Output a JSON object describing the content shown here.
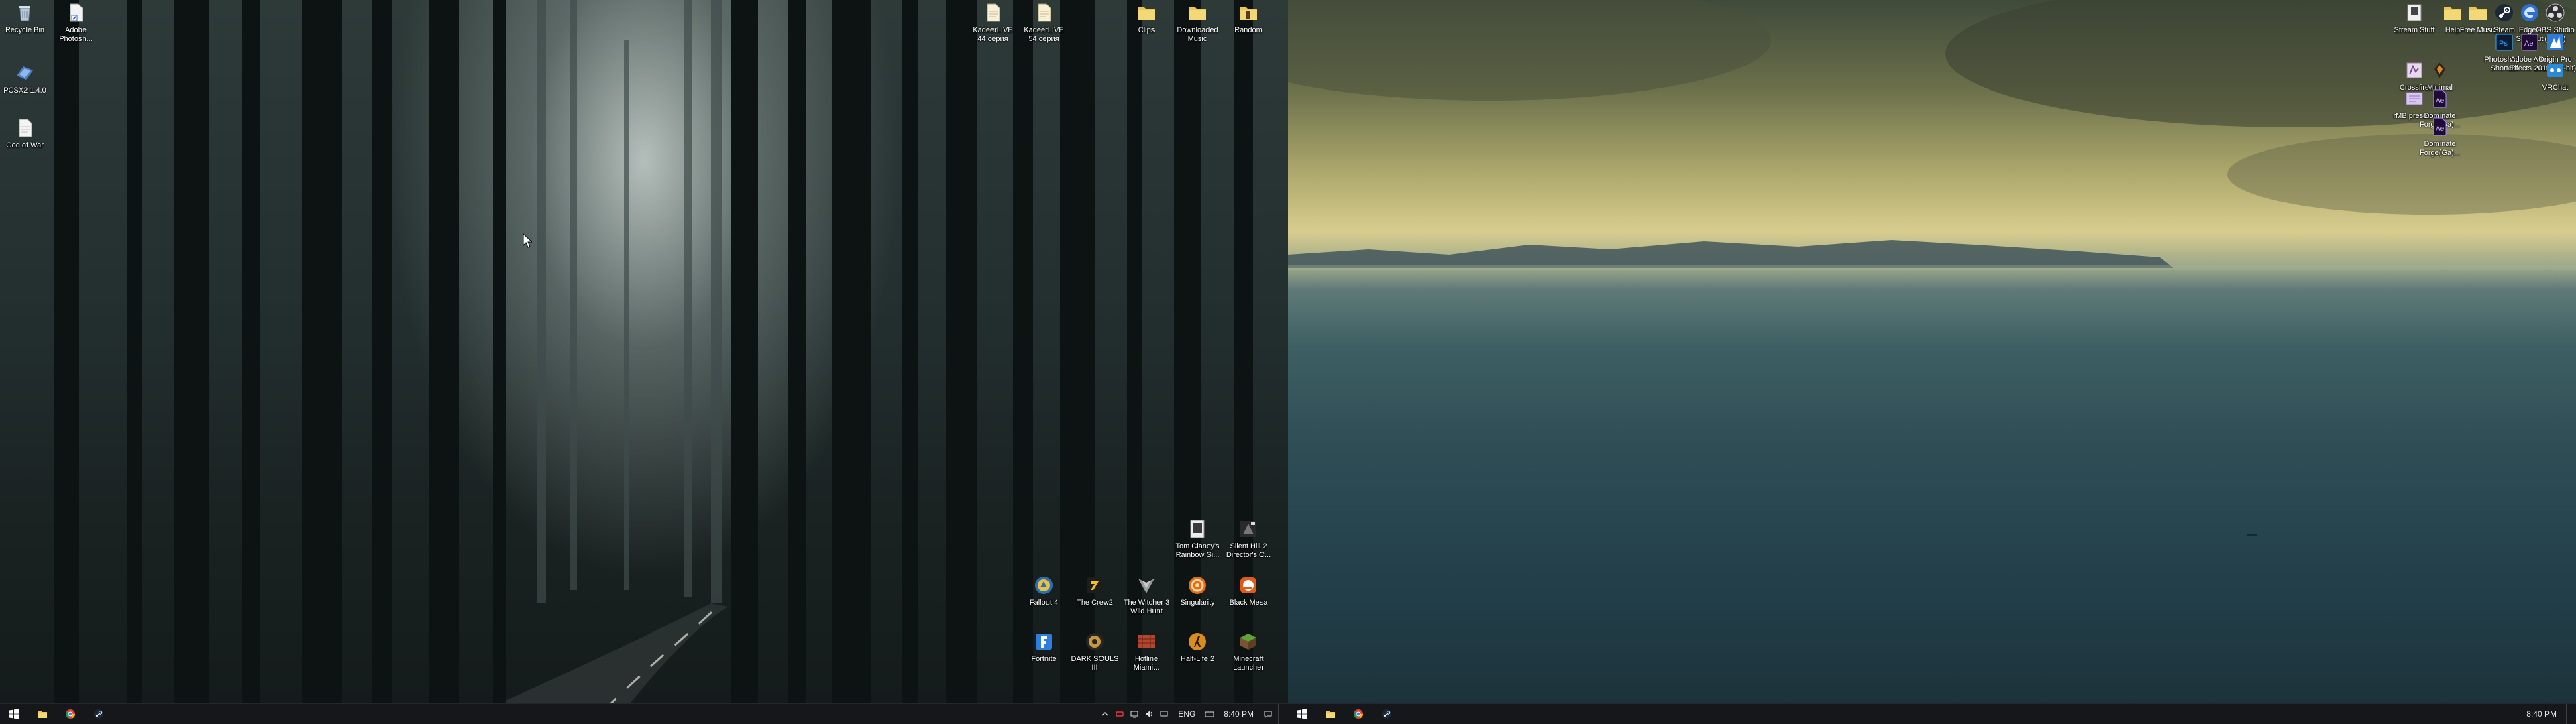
{
  "left_desktop": {
    "icons": [
      {
        "label": "Recycle Bin",
        "icon": "recycle-bin-icon"
      },
      {
        "label": "Adobe Photosh...",
        "icon": "shortcut-document-icon"
      },
      {
        "label": "PCSX2 1.4.0",
        "icon": "pcsx2-icon"
      },
      {
        "label": "God of War",
        "icon": "document-icon"
      },
      {
        "label": "KadeerLIVE 44 серия",
        "icon": "text-file-icon"
      },
      {
        "label": "KadeerLIVE 54 серия",
        "icon": "text-file-icon"
      },
      {
        "label": "Clips",
        "icon": "folder-icon"
      },
      {
        "label": "Downloaded Music",
        "icon": "folder-icon"
      },
      {
        "label": "Random",
        "icon": "folder-icon"
      },
      {
        "label": "Tom Clancy's Rainbow Si...",
        "icon": "rainbow-six-icon"
      },
      {
        "label": "Silent Hill 2 Director's C...",
        "icon": "silent-hill-icon"
      },
      {
        "label": "Fallout 4",
        "icon": "fallout-icon"
      },
      {
        "label": "The Crew2",
        "icon": "the-crew-icon"
      },
      {
        "label": "The Witcher 3 Wild Hunt",
        "icon": "witcher-icon"
      },
      {
        "label": "Singularity",
        "icon": "singularity-icon"
      },
      {
        "label": "Black Mesa",
        "icon": "black-mesa-icon"
      },
      {
        "label": "Fortnite",
        "icon": "fortnite-icon"
      },
      {
        "label": "DARK SOULS III",
        "icon": "dark-souls-icon"
      },
      {
        "label": "Hotline Miami...",
        "icon": "hotline-miami-icon"
      },
      {
        "label": "Half-Life 2",
        "icon": "half-life-icon"
      },
      {
        "label": "Minecraft Launcher",
        "icon": "minecraft-icon"
      }
    ],
    "taskbar": {
      "pinned": [
        {
          "icon": "windows-start-icon"
        },
        {
          "icon": "file-explorer-icon"
        },
        {
          "icon": "chrome-icon"
        },
        {
          "icon": "steam-icon"
        }
      ],
      "tray": {
        "language": "ENG",
        "clock": "8:40 PM"
      }
    }
  },
  "right_desktop": {
    "icons": [
      {
        "label": "Stream Stuff",
        "icon": "stream-icon"
      },
      {
        "label": "Help",
        "icon": "folder-icon"
      },
      {
        "label": "Free Music",
        "icon": "folder-icon"
      },
      {
        "label": "Steam",
        "icon": "steam-icon"
      },
      {
        "label": "Edge - Shortcut",
        "icon": "edge-icon"
      },
      {
        "label": "OBS Studio (64bit)",
        "icon": "obs-icon"
      },
      {
        "label": "Photoshop - Shortcut",
        "icon": "photoshop-icon"
      },
      {
        "label": "Adobe After Effects 2019",
        "icon": "after-effects-icon"
      },
      {
        "label": "Origin Pro 2018 (64-bit)",
        "icon": "origin-icon"
      },
      {
        "label": "Crossfire",
        "icon": "app-icon"
      },
      {
        "label": "Minimal",
        "icon": "app-icon"
      },
      {
        "label": "VRChat",
        "icon": "vr-icon"
      },
      {
        "label": "rMB preset...",
        "icon": "preset-icon"
      },
      {
        "label": "Dominate Forge(Ga)...",
        "icon": "after-effects-file-icon"
      },
      {
        "label": "Dominate Forge(Ga)...",
        "icon": "after-effects-file-icon"
      }
    ],
    "taskbar": {
      "pinned": [
        {
          "icon": "windows-start-icon"
        },
        {
          "icon": "file-explorer-icon"
        },
        {
          "icon": "chrome-icon"
        },
        {
          "icon": "steam-icon"
        }
      ],
      "tray": {
        "clock": "8:40 PM"
      }
    }
  },
  "colors": {
    "taskbar": "#15171a",
    "folder": "#e8c65a",
    "text": "#ffffff"
  }
}
